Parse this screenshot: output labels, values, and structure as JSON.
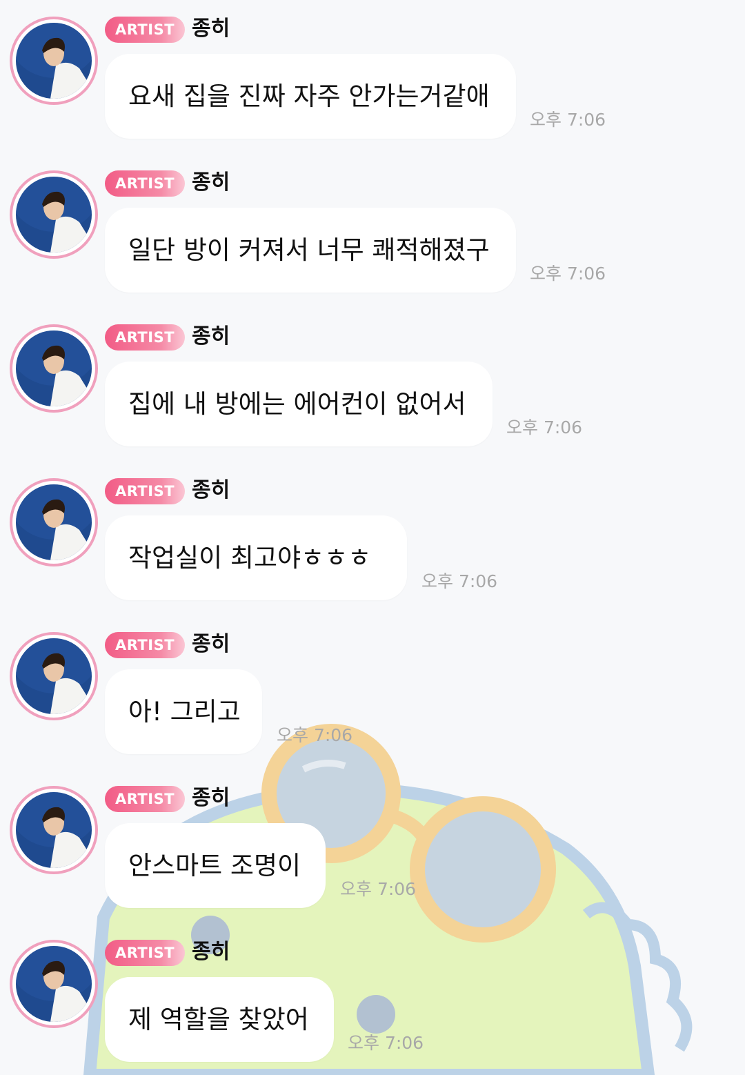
{
  "chat": {
    "messages": [
      {
        "badge": "ARTIST",
        "sender": "종히",
        "text": "요새 집을 진짜 자주 안가는거같애",
        "time": "오후 7:06"
      },
      {
        "badge": "ARTIST",
        "sender": "종히",
        "text": "일단 방이 커져서 너무 쾌적해졌구",
        "time": "오후 7:06"
      },
      {
        "badge": "ARTIST",
        "sender": "종히",
        "text": "집에 내 방에는 에어컨이 없어서",
        "time": "오후 7:06"
      },
      {
        "badge": "ARTIST",
        "sender": "종히",
        "text": "작업실이 최고야ㅎㅎㅎ",
        "time": "오후 7:06"
      },
      {
        "badge": "ARTIST",
        "sender": "종히",
        "text": "아! 그리고",
        "time": "오후 7:06"
      },
      {
        "badge": "ARTIST",
        "sender": "종히",
        "text": "안스마트 조명이",
        "time": "오후 7:06"
      },
      {
        "badge": "ARTIST",
        "sender": "종히",
        "text": "제 역할을 찾았어",
        "time": "오후 7:06"
      }
    ]
  },
  "theme": {
    "badge_color": "#f25c86",
    "avatar_ring": "#f0a0bd",
    "bubble_bg": "#ffffff",
    "timestamp_color": "#a8a8a8",
    "background_color": "#f7f8fa"
  },
  "icons": {
    "background": "frog-with-sunglasses-illustration",
    "avatar": "artist-profile-photo"
  }
}
